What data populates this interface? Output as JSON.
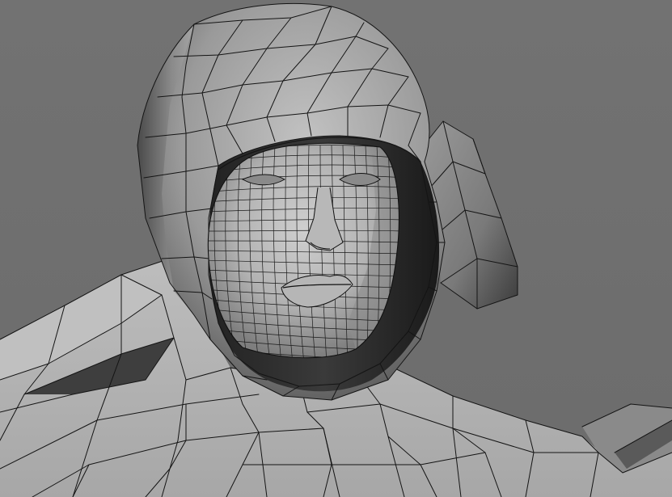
{
  "viewport": {
    "background_color": "#6f6f6f",
    "render_style": "wireframe-on-shaded",
    "subject": "hooded-character-head-mesh",
    "colors": {
      "hood_light": "#b3b3b3",
      "hood_mid": "#8c8c8c",
      "hood_dark": "#3a3a3a",
      "skin_light": "#c4c4c4",
      "skin_mid": "#a3a3a3",
      "wire": "#141414"
    }
  }
}
